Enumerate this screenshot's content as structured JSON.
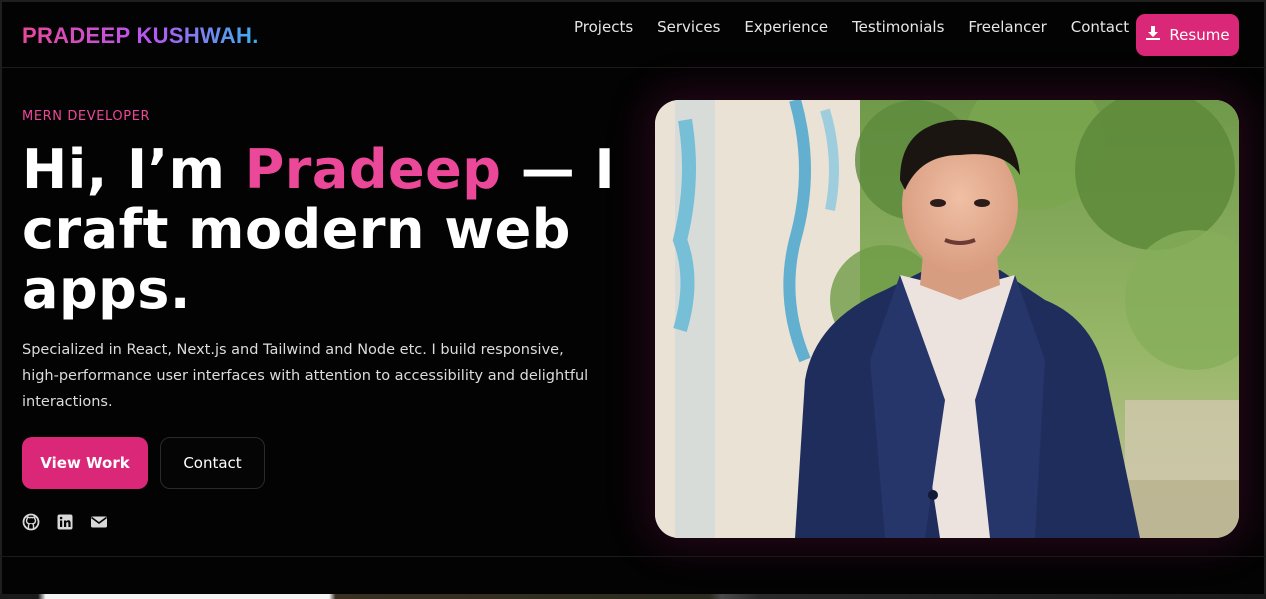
{
  "header": {
    "logo": "PRADEEP KUSHWAH.",
    "nav": [
      "Projects",
      "Services",
      "Experience",
      "Testimonials",
      "Freelancer",
      "Contact"
    ],
    "resume_label": "Resume"
  },
  "hero": {
    "eyebrow": "MERN DEVELOPER",
    "headline_pre": "Hi, I’m ",
    "headline_name": "Pradeep",
    "headline_post": " — I craft modern web apps.",
    "description": "Specialized in React, Next.js and Tailwind and Node etc. I build responsive, high-performance user interfaces with attention to accessibility and delightful interactions.",
    "primary_cta": "View Work",
    "secondary_cta": "Contact",
    "socials": [
      "github-icon",
      "linkedin-icon",
      "mail-icon"
    ]
  },
  "colors": {
    "accent": "#db2777",
    "accent_text": "#ec4899",
    "background": "#030303"
  }
}
